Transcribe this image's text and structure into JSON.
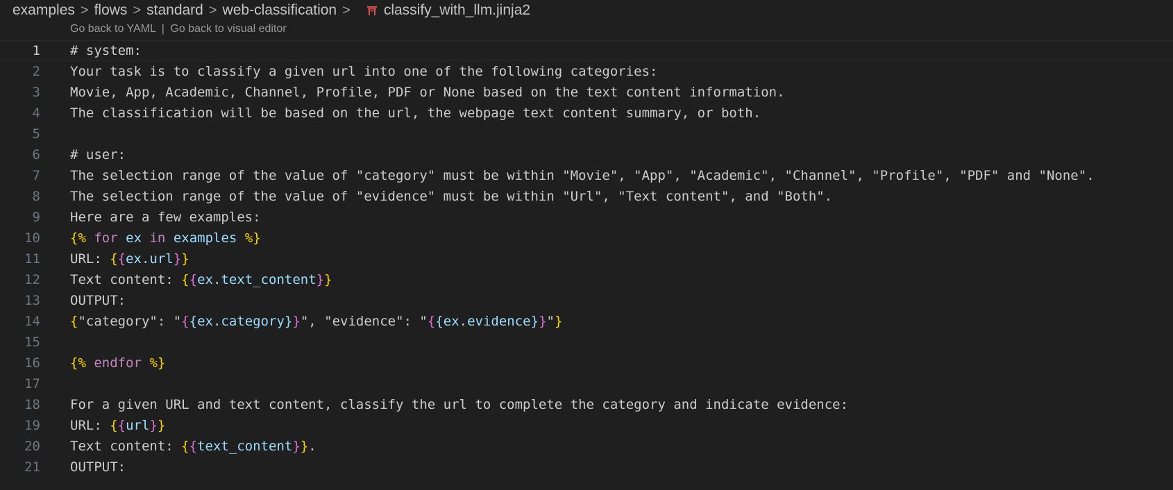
{
  "breadcrumb": {
    "items": [
      "examples",
      "flows",
      "standard",
      "web-classification"
    ],
    "separator": ">",
    "file": "classify_with_llm.jinja2"
  },
  "codelens": {
    "yaml": "Go back to YAML",
    "sep": "|",
    "visual": "Go back to visual editor"
  },
  "colors": {
    "background": "#1f1f1f",
    "jinja_delimiter": "#ffd700",
    "jinja_inner_brace": "#da70d6",
    "keyword": "#c586c0",
    "variable": "#9cdcfe",
    "text": "#cccccc",
    "line_number": "#6e7681"
  },
  "editor": {
    "current_line": 1,
    "lines": [
      {
        "n": "1",
        "tokens": [
          {
            "t": "# system:",
            "c": "text"
          }
        ]
      },
      {
        "n": "2",
        "tokens": [
          {
            "t": "Your task is to classify a given url into one of the following categories:",
            "c": "text"
          }
        ]
      },
      {
        "n": "3",
        "tokens": [
          {
            "t": "Movie, App, Academic, Channel, Profile, PDF or None based on the text content information.",
            "c": "text"
          }
        ]
      },
      {
        "n": "4",
        "tokens": [
          {
            "t": "The classification will be based on the url, the webpage text content summary, or both.",
            "c": "text"
          }
        ]
      },
      {
        "n": "5",
        "tokens": []
      },
      {
        "n": "6",
        "tokens": [
          {
            "t": "# user:",
            "c": "text"
          }
        ]
      },
      {
        "n": "7",
        "tokens": [
          {
            "t": "The selection range of the value of \"category\" must be within \"Movie\", \"App\", \"Academic\", \"Channel\", \"Profile\", \"PDF\" and \"None\".",
            "c": "text"
          }
        ]
      },
      {
        "n": "8",
        "tokens": [
          {
            "t": "The selection range of the value of \"evidence\" must be within \"Url\", \"Text content\", and \"Both\".",
            "c": "text"
          }
        ]
      },
      {
        "n": "9",
        "tokens": [
          {
            "t": "Here are a few examples:",
            "c": "text"
          }
        ]
      },
      {
        "n": "10",
        "tokens": [
          {
            "t": "{%",
            "c": "delim"
          },
          {
            "t": " ",
            "c": "text"
          },
          {
            "t": "for",
            "c": "kw"
          },
          {
            "t": " ",
            "c": "text"
          },
          {
            "t": "ex",
            "c": "var"
          },
          {
            "t": " ",
            "c": "text"
          },
          {
            "t": "in",
            "c": "kw"
          },
          {
            "t": " ",
            "c": "text"
          },
          {
            "t": "examples",
            "c": "var"
          },
          {
            "t": " ",
            "c": "text"
          },
          {
            "t": "%}",
            "c": "delim"
          }
        ]
      },
      {
        "n": "11",
        "tokens": [
          {
            "t": "URL: ",
            "c": "text"
          },
          {
            "t": "{",
            "c": "delim"
          },
          {
            "t": "{",
            "c": "brace2"
          },
          {
            "t": "ex.url",
            "c": "var"
          },
          {
            "t": "}",
            "c": "brace2"
          },
          {
            "t": "}",
            "c": "delim"
          }
        ]
      },
      {
        "n": "12",
        "tokens": [
          {
            "t": "Text content: ",
            "c": "text"
          },
          {
            "t": "{",
            "c": "delim"
          },
          {
            "t": "{",
            "c": "brace2"
          },
          {
            "t": "ex.text_content",
            "c": "var"
          },
          {
            "t": "}",
            "c": "brace2"
          },
          {
            "t": "}",
            "c": "delim"
          }
        ]
      },
      {
        "n": "13",
        "tokens": [
          {
            "t": "OUTPUT:",
            "c": "text"
          }
        ]
      },
      {
        "n": "14",
        "tokens": [
          {
            "t": "{",
            "c": "delim"
          },
          {
            "t": "\"category\": \"",
            "c": "text"
          },
          {
            "t": "{",
            "c": "brace2"
          },
          {
            "t": "{",
            "c": "var"
          },
          {
            "t": "ex.category",
            "c": "var"
          },
          {
            "t": "}",
            "c": "var"
          },
          {
            "t": "}",
            "c": "brace2"
          },
          {
            "t": "\", \"evidence\": \"",
            "c": "text"
          },
          {
            "t": "{",
            "c": "brace2"
          },
          {
            "t": "{",
            "c": "var"
          },
          {
            "t": "ex.evidence",
            "c": "var"
          },
          {
            "t": "}",
            "c": "var"
          },
          {
            "t": "}",
            "c": "brace2"
          },
          {
            "t": "\"",
            "c": "text"
          },
          {
            "t": "}",
            "c": "delim"
          }
        ]
      },
      {
        "n": "15",
        "tokens": []
      },
      {
        "n": "16",
        "tokens": [
          {
            "t": "{%",
            "c": "delim"
          },
          {
            "t": " ",
            "c": "text"
          },
          {
            "t": "endfor",
            "c": "kw"
          },
          {
            "t": " ",
            "c": "text"
          },
          {
            "t": "%}",
            "c": "delim"
          }
        ]
      },
      {
        "n": "17",
        "tokens": []
      },
      {
        "n": "18",
        "tokens": [
          {
            "t": "For a given URL and text content, classify the url to complete the category and indicate evidence:",
            "c": "text"
          }
        ]
      },
      {
        "n": "19",
        "tokens": [
          {
            "t": "URL: ",
            "c": "text"
          },
          {
            "t": "{",
            "c": "delim"
          },
          {
            "t": "{",
            "c": "brace2"
          },
          {
            "t": "url",
            "c": "var"
          },
          {
            "t": "}",
            "c": "brace2"
          },
          {
            "t": "}",
            "c": "delim"
          }
        ]
      },
      {
        "n": "20",
        "tokens": [
          {
            "t": "Text content: ",
            "c": "text"
          },
          {
            "t": "{",
            "c": "delim"
          },
          {
            "t": "{",
            "c": "brace2"
          },
          {
            "t": "text_content",
            "c": "var"
          },
          {
            "t": "}",
            "c": "brace2"
          },
          {
            "t": "}",
            "c": "delim"
          },
          {
            "t": ".",
            "c": "text"
          }
        ]
      },
      {
        "n": "21",
        "tokens": [
          {
            "t": "OUTPUT:",
            "c": "text"
          }
        ]
      }
    ]
  }
}
